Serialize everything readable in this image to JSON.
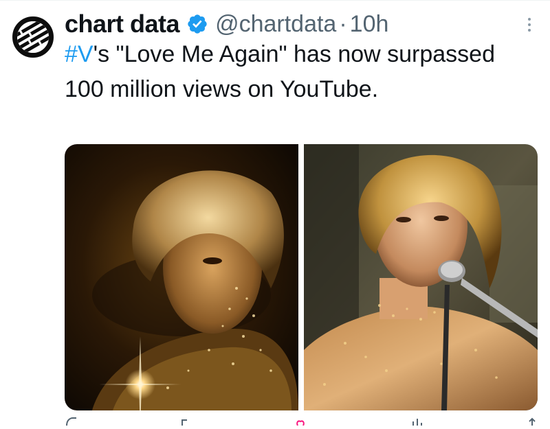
{
  "tweet": {
    "author_name": "chart data",
    "handle": "@chartdata",
    "separator": "·",
    "time": "10h",
    "hashtag": "#V",
    "text_rest": "'s \"Love Me Again\" has now surpassed 100 million views on YouTube.",
    "verified": true
  },
  "icons": {
    "verified": "verified-badge-icon",
    "more": "more-options-icon",
    "reply": "reply-icon",
    "retweet": "retweet-icon",
    "like": "like-icon",
    "views": "views-icon",
    "share": "share-icon"
  },
  "colors": {
    "link": "#1d9bf0",
    "text": "#0f1419",
    "secondary": "#536471",
    "verified": "#1d9bf0"
  },
  "media": {
    "count": 2
  }
}
